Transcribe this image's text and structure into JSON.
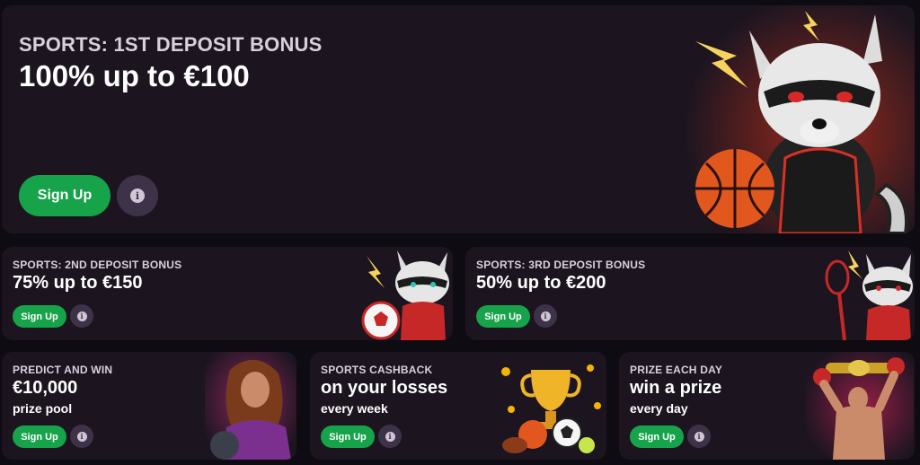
{
  "hero": {
    "overline": "SPORTS: 1ST DEPOSIT BONUS",
    "headline": "100% up to €100",
    "signup_label": "Sign Up",
    "info_glyph": "i",
    "illustration": "raccoon-basketball-icon"
  },
  "cards": [
    {
      "overline": "SPORTS: 2ND DEPOSIT BONUS",
      "headline": "75% up to €150",
      "signup_label": "Sign Up",
      "info_glyph": "i",
      "illustration": "raccoon-soccer-icon"
    },
    {
      "overline": "SPORTS: 3RD DEPOSIT BONUS",
      "headline": "50% up to €200",
      "signup_label": "Sign Up",
      "info_glyph": "i",
      "illustration": "raccoon-tennis-icon"
    },
    {
      "overline": "PREDICT AND WIN",
      "headline": "€10,000",
      "sub": "prize pool",
      "signup_label": "Sign Up",
      "info_glyph": "i",
      "illustration": "woman-football-icon"
    },
    {
      "overline": "SPORTS CASHBACK",
      "headline": "on your losses",
      "sub": "every week",
      "signup_label": "Sign Up",
      "info_glyph": "i",
      "illustration": "trophy-balls-icon"
    },
    {
      "overline": "PRIZE EACH DAY",
      "headline": "win a prize",
      "sub": "every day",
      "signup_label": "Sign Up",
      "info_glyph": "i",
      "illustration": "boxer-belt-icon"
    }
  ],
  "colors": {
    "background": "#0f0b12",
    "card": "#1c1520",
    "accent_green": "#17a34a",
    "info_button": "#3d3247"
  }
}
